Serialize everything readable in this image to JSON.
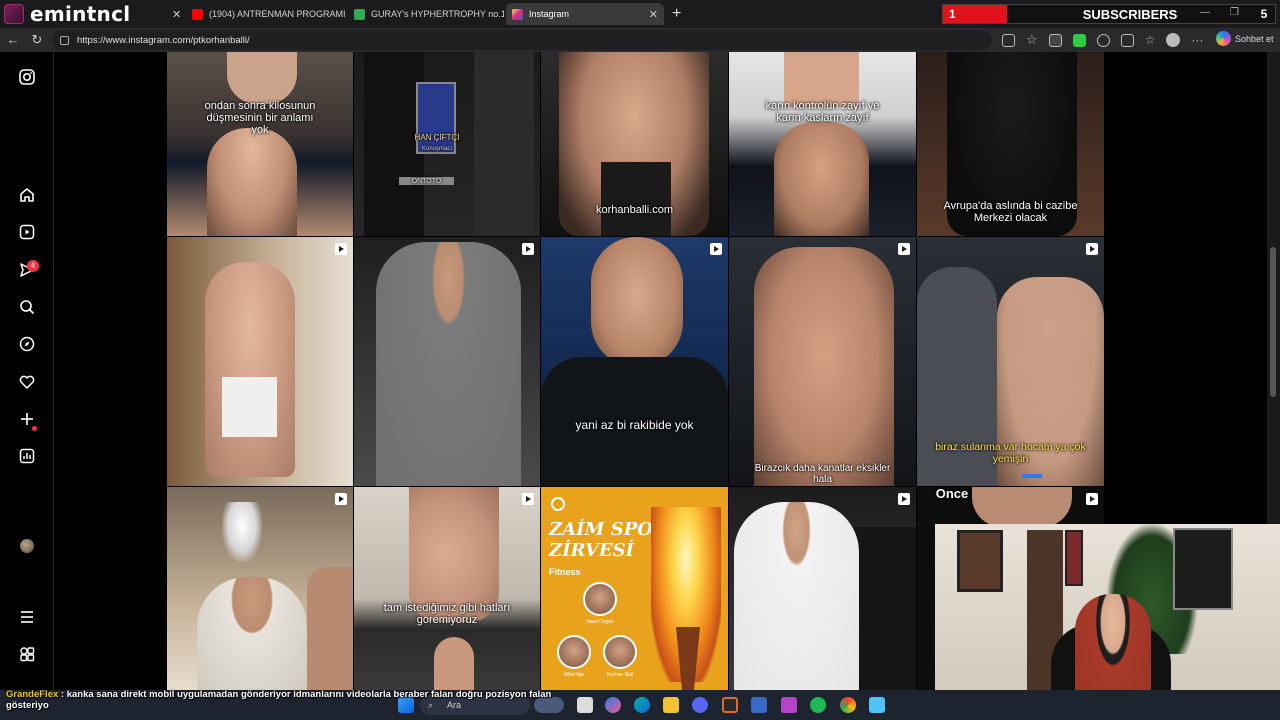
{
  "window": {
    "brand_text": "emintncl",
    "tabs": [
      {
        "label": "(1904) ANTRENMAN PROGRAMI ·",
        "favicon_color": "#ff0000"
      },
      {
        "label": "GURAY's HYPHERTROPHY no.1.pdf",
        "favicon_color": "#34a853"
      },
      {
        "label": "Instagram",
        "favicon_color": "#e1306c"
      }
    ],
    "new_tab_symbol": "+",
    "address": "https://www.instagram.com/ptkorhanballi/",
    "copilot_label": "Sohbet et"
  },
  "subscribers": {
    "count": "1",
    "label": "SUBSCRIBERS",
    "goal": "5",
    "accent": "#e0121a"
  },
  "instagram": {
    "sidebar_icons": [
      "instagram-logo-icon",
      "home-icon",
      "reels-icon",
      "messages-icon",
      "search-icon",
      "explore-icon",
      "notifications-icon",
      "create-icon",
      "dashboard-icon",
      "profile-avatar-icon",
      "more-menu-icon",
      "also-from-meta-icon"
    ],
    "messages_badge": "4",
    "captions": {
      "r0c0": "ondan sonra kilosunun düşmesinin bir anlamı yok",
      "r0c2": "korhanballi.com",
      "r0c3": "karın kontrolün zayıf ve karın kasların zayıf",
      "r0c4": "Avrupa'da aslında bi cazibe Merkezi olacak",
      "r0c1_sign": "HAN ÇİFTÇİ",
      "r0c1_sign_sub": "Konuşmacı",
      "r0c1_stage": "ONTOTO",
      "r1c2": "yani az bi rakibide yok",
      "r1c3": "Birazcık daha kanatlar eksikler hala",
      "r1c4": "biraz sulanma var hocam ya çok yemişin",
      "r2c1": "tam istediğimiz gibi hatları göremiyoruz",
      "r2c4": "Once"
    },
    "poster": {
      "title_line1": "ZAİM SPOR",
      "title_line2": "ZİRVESİ",
      "subtitle": "Fitness",
      "speakers": [
        "Nasıl Ozgan",
        "Kibel Ilge",
        "Korhan Ball"
      ]
    }
  },
  "stream_chat": {
    "username": "GrandeFlex",
    "separator": ":",
    "message": "kanka sana direkt mobil uygulamadan gönderiyor idmanlarını videolarla beraber falan doğru pozisyon falan gösteriyo"
  },
  "taskbar": {
    "search_placeholder": "Ara",
    "app_icons": [
      "windows-start-icon",
      "task-view-icon",
      "copilot-icon",
      "edge-icon",
      "edge-beta-icon",
      "file-explorer-icon",
      "discord-icon",
      "obs-icon",
      "streamlabs-icon",
      "messenger-icon",
      "spotify-icon",
      "chrome-icon",
      "notepad-icon"
    ]
  }
}
